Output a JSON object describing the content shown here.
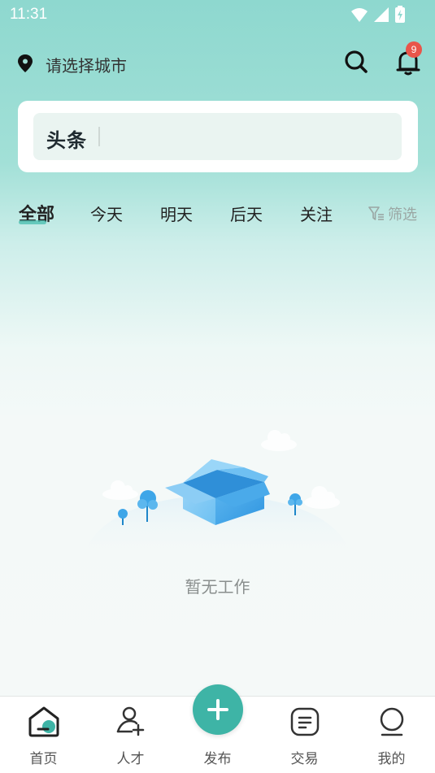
{
  "status_bar": {
    "time": "11:31"
  },
  "header": {
    "location_placeholder": "请选择城市",
    "notification_count": "9",
    "icons": [
      "location-pin-icon",
      "search-icon",
      "bell-icon"
    ]
  },
  "news_card": {
    "logo_text": "头条"
  },
  "tabs": {
    "items": [
      {
        "label": "全部",
        "active": true
      },
      {
        "label": "今天",
        "active": false
      },
      {
        "label": "明天",
        "active": false
      },
      {
        "label": "后天",
        "active": false
      },
      {
        "label": "关注",
        "active": false
      }
    ],
    "filter_label": "筛选"
  },
  "empty_state": {
    "message": "暂无工作"
  },
  "bottom_nav": {
    "items": [
      {
        "label": "首页",
        "icon": "home-icon",
        "active": true
      },
      {
        "label": "人才",
        "icon": "add-person-icon",
        "active": false
      },
      {
        "label": "发布",
        "icon": "plus-icon",
        "active": false
      },
      {
        "label": "交易",
        "icon": "document-icon",
        "active": false
      },
      {
        "label": "我的",
        "icon": "profile-icon",
        "active": false
      }
    ]
  },
  "colors": {
    "accent": "#3eb4a6",
    "badge": "#e9554a",
    "header_bg": "#8ed8cf"
  }
}
